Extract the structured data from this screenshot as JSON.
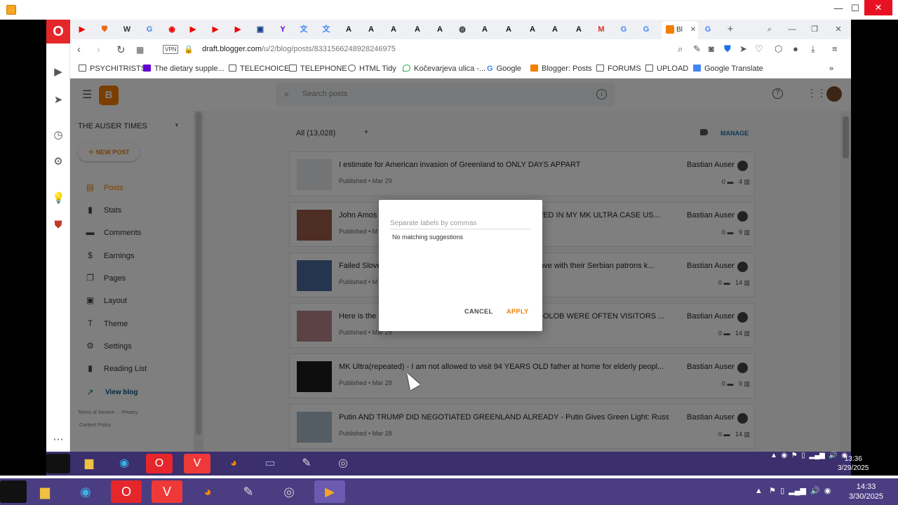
{
  "browser": {
    "url_host": "draft.blogger.com",
    "url_path": "/u/2/blog/posts/8331566248928246975",
    "vpn_label": "VPN",
    "active_tab_label": "Bl"
  },
  "bookmarks": [
    {
      "label": "PSYCHITRISTS",
      "icon": "folder-icon"
    },
    {
      "label": "The dietary supple...",
      "icon": "yahoo-icon"
    },
    {
      "label": "TELECHOICE",
      "icon": "folder-icon"
    },
    {
      "label": "TELEPHONE",
      "icon": "folder-icon"
    },
    {
      "label": "HTML Tidy",
      "icon": "tidy-icon"
    },
    {
      "label": "Kočevarjeva ulica -...",
      "icon": "maps-pin-icon"
    },
    {
      "label": "Google",
      "icon": "google-icon"
    },
    {
      "label": "Blogger: Posts",
      "icon": "blogger-icon"
    },
    {
      "label": "FORUMS",
      "icon": "folder-icon"
    },
    {
      "label": "UPLOAD",
      "icon": "folder-icon"
    },
    {
      "label": "Google Translate",
      "icon": "translate-icon"
    }
  ],
  "blogger": {
    "search_placeholder": "Search posts",
    "blog_name": "THE AUSER TIMES",
    "new_post": "NEW POST",
    "nav": [
      {
        "label": "Posts",
        "icon": "posts-icon",
        "active": true
      },
      {
        "label": "Stats",
        "icon": "stats-icon"
      },
      {
        "label": "Comments",
        "icon": "comments-icon"
      },
      {
        "label": "Earnings",
        "icon": "dollar-icon"
      },
      {
        "label": "Pages",
        "icon": "pages-icon"
      },
      {
        "label": "Layout",
        "icon": "layout-icon"
      },
      {
        "label": "Theme",
        "icon": "theme-icon"
      },
      {
        "label": "Settings",
        "icon": "gear-icon"
      },
      {
        "label": "Reading List",
        "icon": "bookmark-icon"
      },
      {
        "label": "View blog",
        "icon": "external-link-icon"
      }
    ],
    "footer": {
      "terms": "Terms of Service",
      "privacy": "Privacy",
      "content_policy": "Content Policy"
    },
    "filter": "All (13,028)",
    "manage": "MANAGE",
    "posts": [
      {
        "title": "I estimate for American invasion of Greenland to ONLY DAYS APPART",
        "meta": "Published • Mar 29",
        "author": "Bastian Auser",
        "comments": "0",
        "views": "4"
      },
      {
        "title": "John Amos",
        "title_tail": "OLVED IN MY MK ULTRA CASE US...",
        "meta": "Published • M",
        "author": "Bastian Auser",
        "comments": "0",
        "views": "9"
      },
      {
        "title": "Failed Slove",
        "title_tail": "have with their Serbian patrons k...",
        "meta": "Published • M",
        "author": "Bastian Auser",
        "comments": "0",
        "views": "14"
      },
      {
        "title": "Here is the",
        "title_tail": "S/GOLOB WERE OFTEN VISITORS ...",
        "meta": "Published • Mar 29",
        "author": "Bastian Auser",
        "comments": "0",
        "views": "14"
      },
      {
        "title": "MK Ultra(repeated) - I am not allowed to visit 94 YEARS OLD father at home for elderly peopl...",
        "meta": "Published • Mar 28",
        "author": "Bastian Auser",
        "comments": "0",
        "views": "9"
      },
      {
        "title": "Putin AND TRUMP DID NEGOTIATED GREENLAND ALREADY - Putin Gives Green Light: Russia...",
        "meta": "Published • Mar 28",
        "author": "Bastian Auser",
        "comments": "0",
        "views": "14"
      }
    ],
    "dialog": {
      "placeholder": "Separate labels by commas",
      "no_match": "No matching suggestions",
      "cancel": "CANCEL",
      "apply": "APPLY"
    }
  },
  "inner_clock": {
    "time": "13:36",
    "date": "3/29/2025"
  },
  "outer_clock": {
    "time": "14:33",
    "date": "3/30/2025"
  },
  "colors": {
    "blogger_orange": "#f57d00",
    "opera_red": "#e5262b",
    "taskbar": "#4a3d82"
  }
}
